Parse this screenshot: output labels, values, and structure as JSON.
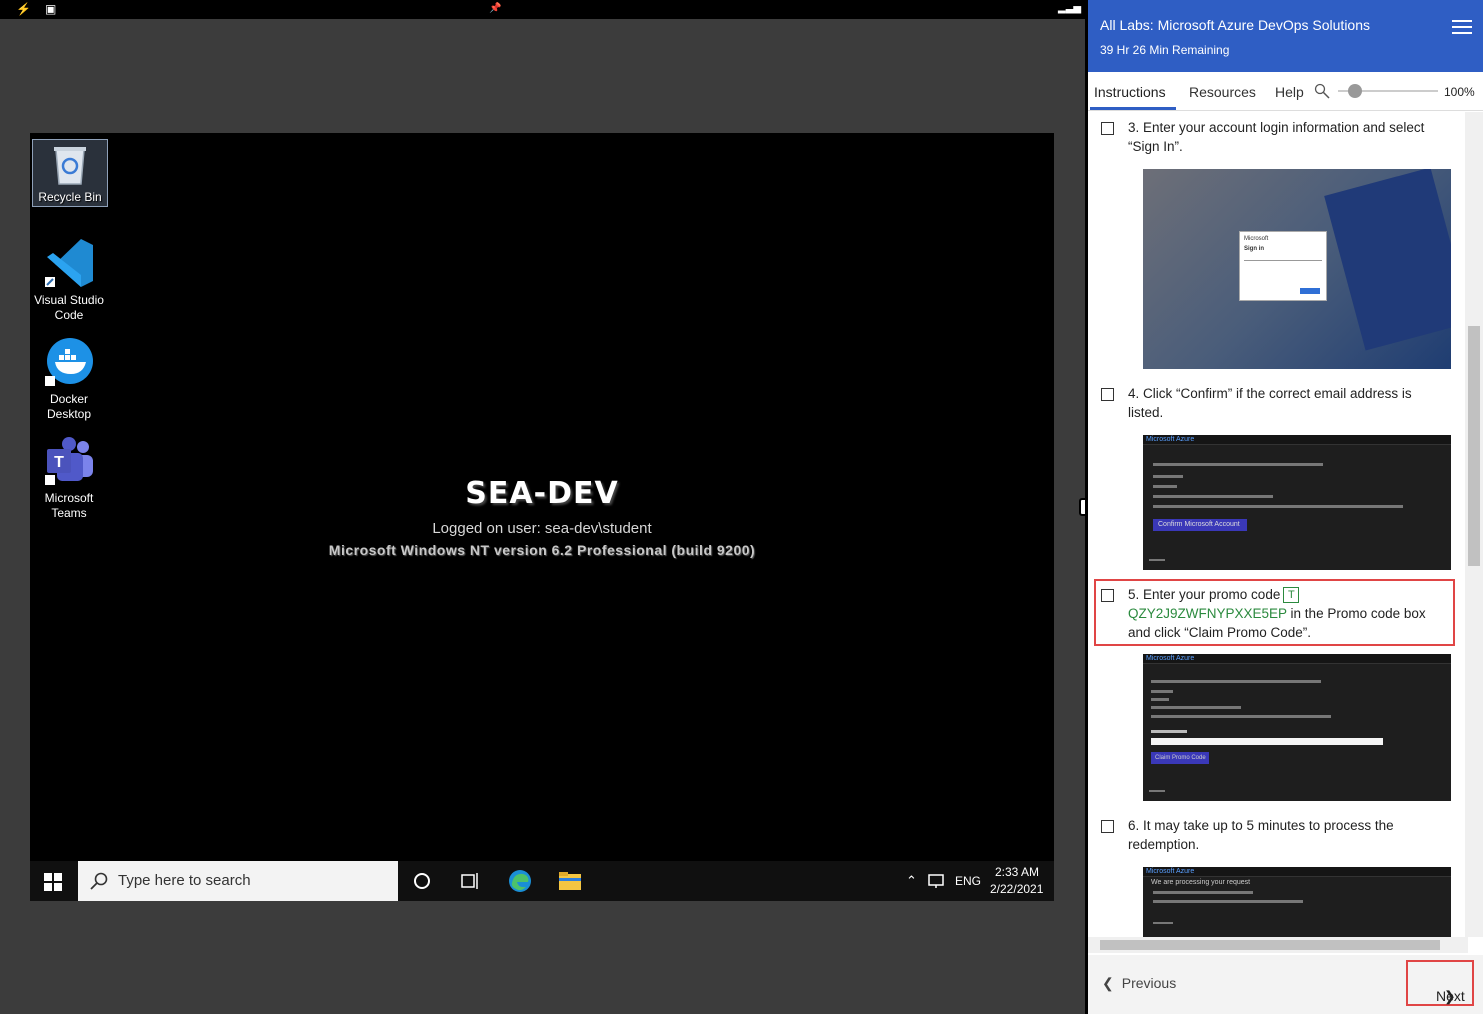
{
  "vm": {
    "icons": [
      {
        "label": "Recycle Bin"
      },
      {
        "label": "Visual Studio Code"
      },
      {
        "label": "Docker Desktop"
      },
      {
        "label": "Microsoft Teams"
      }
    ],
    "hostname": "SEA-DEV",
    "logged_on": "Logged on user: sea-dev\\student",
    "os_version": "Microsoft Windows NT version 6.2 Professional  (build 9200)",
    "taskbar": {
      "search_placeholder": "Type here to search",
      "lang": "ENG",
      "time": "2:33 AM",
      "date": "2/22/2021"
    }
  },
  "panel": {
    "title": "All Labs: Microsoft Azure DevOps Solutions",
    "remaining": "39 Hr 26 Min Remaining",
    "tabs": [
      "Instructions",
      "Resources",
      "Help"
    ],
    "zoom": "100%",
    "zoom_level": 1.0,
    "steps": [
      {
        "text": "3. Enter your account login information and select “Sign In”."
      },
      {
        "text": "4. Click “Confirm” if the correct email address is listed."
      },
      {
        "prefix": "5. Enter your promo code",
        "code": "QZY2J9ZWFNYPXXE5EP",
        "suffix": " in the Promo code box and click “Claim Promo Code”."
      },
      {
        "text": "6. It may take up to 5 minutes to process the redemption."
      }
    ],
    "shot_labels": {
      "ms": "Microsoft",
      "signin": "Sign in",
      "azure": "Microsoft Azure",
      "confirm": "Confirm Microsoft Account",
      "claim": "Claim Promo Code",
      "processing": "We are processing your request"
    },
    "footer": {
      "previous": "Previous",
      "next": "Next"
    }
  }
}
